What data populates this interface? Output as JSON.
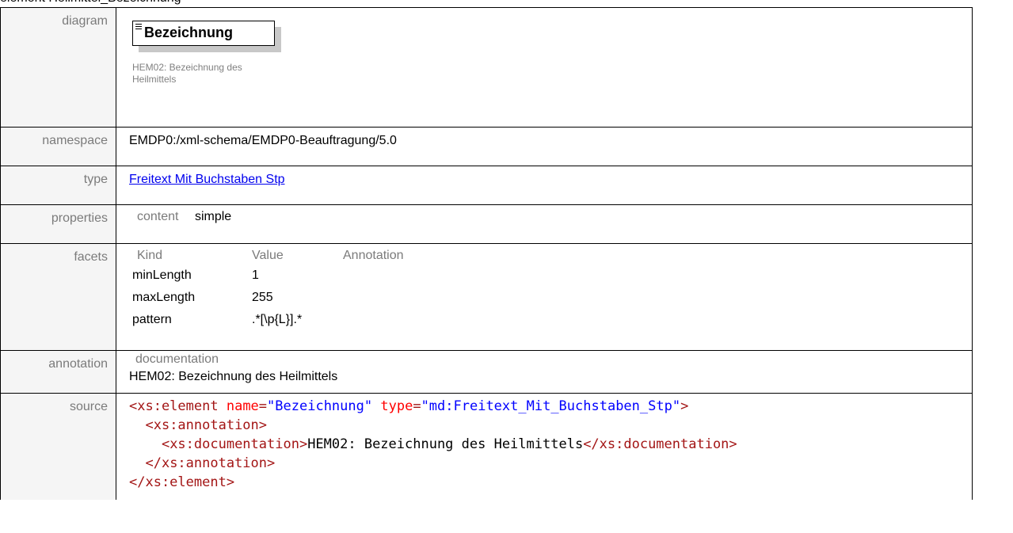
{
  "top_text": "element Heilmittel_Bezeichnung",
  "rows": {
    "diagram": {
      "label": "diagram",
      "element_name": "Bezeichnung",
      "doc": "HEM02: Bezeichnung des Heilmittels"
    },
    "namespace": {
      "label": "namespace",
      "value": "EMDP0:/xml-schema/EMDP0-Beauftragung/5.0"
    },
    "type": {
      "label": "type",
      "value": "Freitext Mit Buchstaben Stp"
    },
    "properties": {
      "label": "properties",
      "key": "content",
      "value": "simple"
    },
    "facets": {
      "label": "facets",
      "headers": [
        "Kind",
        "Value",
        "Annotation"
      ],
      "rows": [
        {
          "kind": "minLength",
          "value": "1",
          "annotation": ""
        },
        {
          "kind": "maxLength",
          "value": "255",
          "annotation": ""
        },
        {
          "kind": "pattern",
          "value": ".*[\\p{L}].*",
          "annotation": ""
        }
      ]
    },
    "annotation": {
      "label": "annotation",
      "head": "documentation",
      "text": "HEM02: Bezeichnung des Heilmittels"
    },
    "source": {
      "label": "source",
      "line1_tag": "<xs:element",
      "line1_attr1": "name",
      "line1_val1": "\"Bezeichnung\"",
      "line1_attr2": "type",
      "line1_val2": "\"md:Freitext_Mit_Buchstaben_Stp\"",
      "line1_end": ">",
      "line2": "<xs:annotation>",
      "line3_open": "<xs:documentation>",
      "line3_text": "HEM02: Bezeichnung des Heilmittels",
      "line3_close": "</xs:documentation>",
      "line4": "</xs:annotation>",
      "line5": "</xs:element>"
    }
  }
}
